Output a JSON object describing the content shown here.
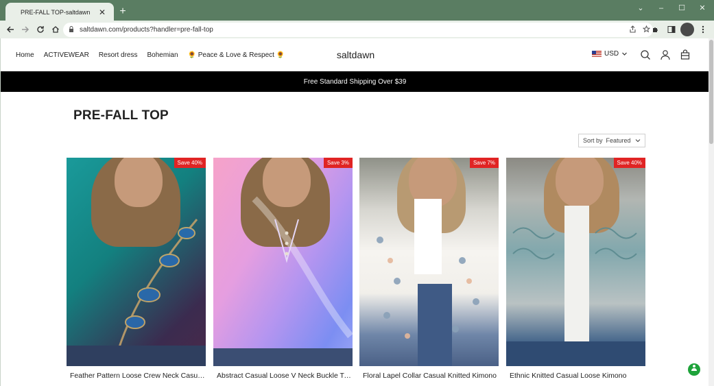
{
  "browser": {
    "tab_title": "PRE-FALL TOP-saltdawn",
    "tab_close": "✕",
    "new_tab": "+",
    "url": "saltdawn.com/products?handler=pre-fall-top",
    "window_controls": [
      "⌄",
      "–",
      "☐",
      "✕"
    ]
  },
  "header": {
    "menu": [
      "Home",
      "ACTIVEWEAR",
      "Resort dress",
      "Bohemian",
      "🌻 Peace & Love & Respect 🌻"
    ],
    "brand": "saltdawn",
    "currency": "USD"
  },
  "banner": {
    "text": "Free Standard Shipping Over $39"
  },
  "collection": {
    "title": "PRE-FALL TOP",
    "sort_label": "Sort by",
    "sort_value": "Featured"
  },
  "products": [
    {
      "name": "Feather Pattern Loose Crew Neck Casual T-shirt",
      "badge": "Save 40%"
    },
    {
      "name": "Abstract Casual Loose V Neck Buckle T-shirt",
      "badge": "Save 3%"
    },
    {
      "name": "Floral Lapel Collar Casual Knitted Kimono",
      "badge": "Save 7%"
    },
    {
      "name": "Ethnic Knitted Casual Loose Kimono",
      "badge": "Save 40%"
    }
  ],
  "colors": {
    "browser_frame": "#5a7d62",
    "toolbar": "#e9efe8",
    "banner_bg": "#000000",
    "badge_bg": "#e02424",
    "help_button": "#1ea33a"
  },
  "icons": [
    "back-icon",
    "forward-icon",
    "reload-icon",
    "home-icon",
    "lock-icon",
    "share-icon",
    "star-icon",
    "extensions-icon",
    "sidepanel-icon",
    "profile-icon",
    "kebab-icon",
    "search-icon",
    "account-icon",
    "cart-icon",
    "chevron-down-icon",
    "help-icon"
  ]
}
